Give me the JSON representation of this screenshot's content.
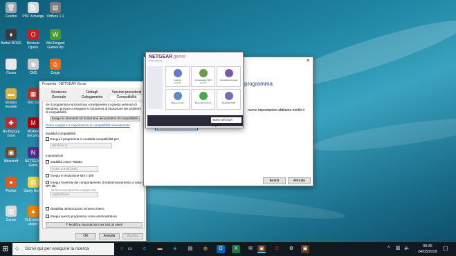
{
  "desktop": {
    "icons": [
      {
        "label": "Cestino",
        "icon": "recycle-bin-icon",
        "color": "#9aa7b0",
        "glyph": "🗑"
      },
      {
        "label": "PDF Xchange",
        "icon": "pdf-icon",
        "color": "#d8d8d8",
        "glyph": "📄"
      },
      {
        "label": "VirBura 1.1",
        "icon": "app-icon",
        "color": "#7d7d7d",
        "glyph": "▤"
      },
      {
        "label": "Bethel BOSS",
        "icon": "app-icon",
        "color": "#3a3a3a",
        "glyph": "♦"
      },
      {
        "label": "Browser Opera",
        "icon": "opera-icon",
        "color": "#cc1b25",
        "glyph": "O"
      },
      {
        "label": "WikiTangent Games Ap",
        "icon": "games-icon",
        "color": "#4a9a2a",
        "glyph": "W"
      },
      {
        "label": "iTunes",
        "icon": "itunes-icon",
        "color": "#e8e8ef",
        "glyph": "♫"
      },
      {
        "label": "CMS",
        "icon": "webcam-icon",
        "color": "#c8c8c8",
        "glyph": "◉"
      },
      {
        "label": "Origin",
        "icon": "origin-icon",
        "color": "#f06a18",
        "glyph": "◎"
      },
      {
        "label": "Modulo invalide",
        "icon": "folder-icon",
        "color": "#e0b040",
        "glyph": "▬"
      },
      {
        "label": "Doc Ca",
        "icon": "document-icon",
        "color": "#b03030",
        "glyph": "▦"
      },
      {
        "label": "No-Backup Zone",
        "icon": "backup-icon",
        "color": "#c02a2a",
        "glyph": "✚"
      },
      {
        "label": "McAfee Security",
        "icon": "mcafee-icon",
        "color": "#b00000",
        "glyph": "M"
      },
      {
        "label": "Minecraft",
        "icon": "minecraft-icon",
        "color": "#6b4a2a",
        "glyph": "▣"
      },
      {
        "label": "NETGEAR Genie",
        "icon": "netgear-icon",
        "color": "#5a2a8a",
        "glyph": "N"
      },
      {
        "label": "Firefox",
        "icon": "firefox-icon",
        "color": "#e05a1a",
        "glyph": "●"
      },
      {
        "label": "Sticky Notes",
        "icon": "notes-icon",
        "color": "#e8d84a",
        "glyph": "▤"
      },
      {
        "label": "Canon",
        "icon": "canon-icon",
        "color": "#d8d8d8",
        "glyph": "▥"
      },
      {
        "label": "VLC media player",
        "icon": "vlc-icon",
        "color": "#f08000",
        "glyph": "▲"
      }
    ]
  },
  "props": {
    "title": "Proprietà - NETGEAR Genie",
    "tabs_row1": [
      "Sicurezza",
      "Dettagli",
      "Versioni precedenti"
    ],
    "tabs_row2": [
      "Generale",
      "Collegamento",
      "Compatibilità"
    ],
    "intro": "Se il programma non funziona correttamente in questa versione di Windows, provare a eseguire lo strumento di risoluzione dei problemi di compatibilità.",
    "troubleshoot_btn": "Esegui lo strumento di risoluzione dei problemi di compatibilità",
    "manual_link": "Come scegliere le impostazioni di compatibilità manualmente",
    "compat_mode_heading": "Modalità compatibilità",
    "compat_mode_check": "Esegui il programma in modalità compatibilità per:",
    "compat_mode_value": "Windows 8",
    "settings_heading": "Impostazioni",
    "reduced_color": "Modalità colore Ridotto",
    "color_value": "Colori a 8 bit (256)",
    "res_640": "Esegui in risoluzione 640 x 480",
    "dpi_override": "Esegui l'override del comportamento di ridimensionamento a valori DPI alti.",
    "dpi_sub": "Ridimensionamento eseguito da:",
    "dpi_value": "Applicazione",
    "fullscreen_opt": "Disabilita ottimizzazioni schermo intero",
    "run_admin": "Esegui questo programma come amministratore",
    "all_users_btn": "Modifica impostazioni per tutti gli utenti",
    "ok": "OK",
    "cancel": "Annulla",
    "apply": "Applica"
  },
  "wizard": {
    "heading": "programma",
    "text": "nuove impostazioni abbiamo risolto il",
    "test_btn": "Testa il programma...",
    "next": "Avanti",
    "cancel": "Annulla"
  },
  "genie": {
    "brand": "NETGEAR",
    "product": "genie",
    "tagline": "Smart network.",
    "status_left": "Internet",
    "tiles": [
      {
        "label": "Internet",
        "status": "GOOD",
        "color": "#6a7ac8"
      },
      {
        "label": "Connessione WiFi",
        "status": "GOOD",
        "color": "#6a9a4a"
      },
      {
        "label": "Impostazioni router",
        "status": "",
        "color": "#7a5aa8"
      },
      {
        "label": "Mappa di rete",
        "status": "",
        "color": "#5a8ac8"
      },
      {
        "label": "Parental Controls",
        "status": "",
        "color": "#4aa84a"
      },
      {
        "label": "ReadySHARE",
        "status": "",
        "color": "#7a6ab8"
      }
    ],
    "search_text": "Search NETGEAR Support"
  },
  "taskbar": {
    "search_placeholder": "Scrivi qui per eseguire la ricerca",
    "time": "09:35",
    "date": "24/03/2018"
  }
}
